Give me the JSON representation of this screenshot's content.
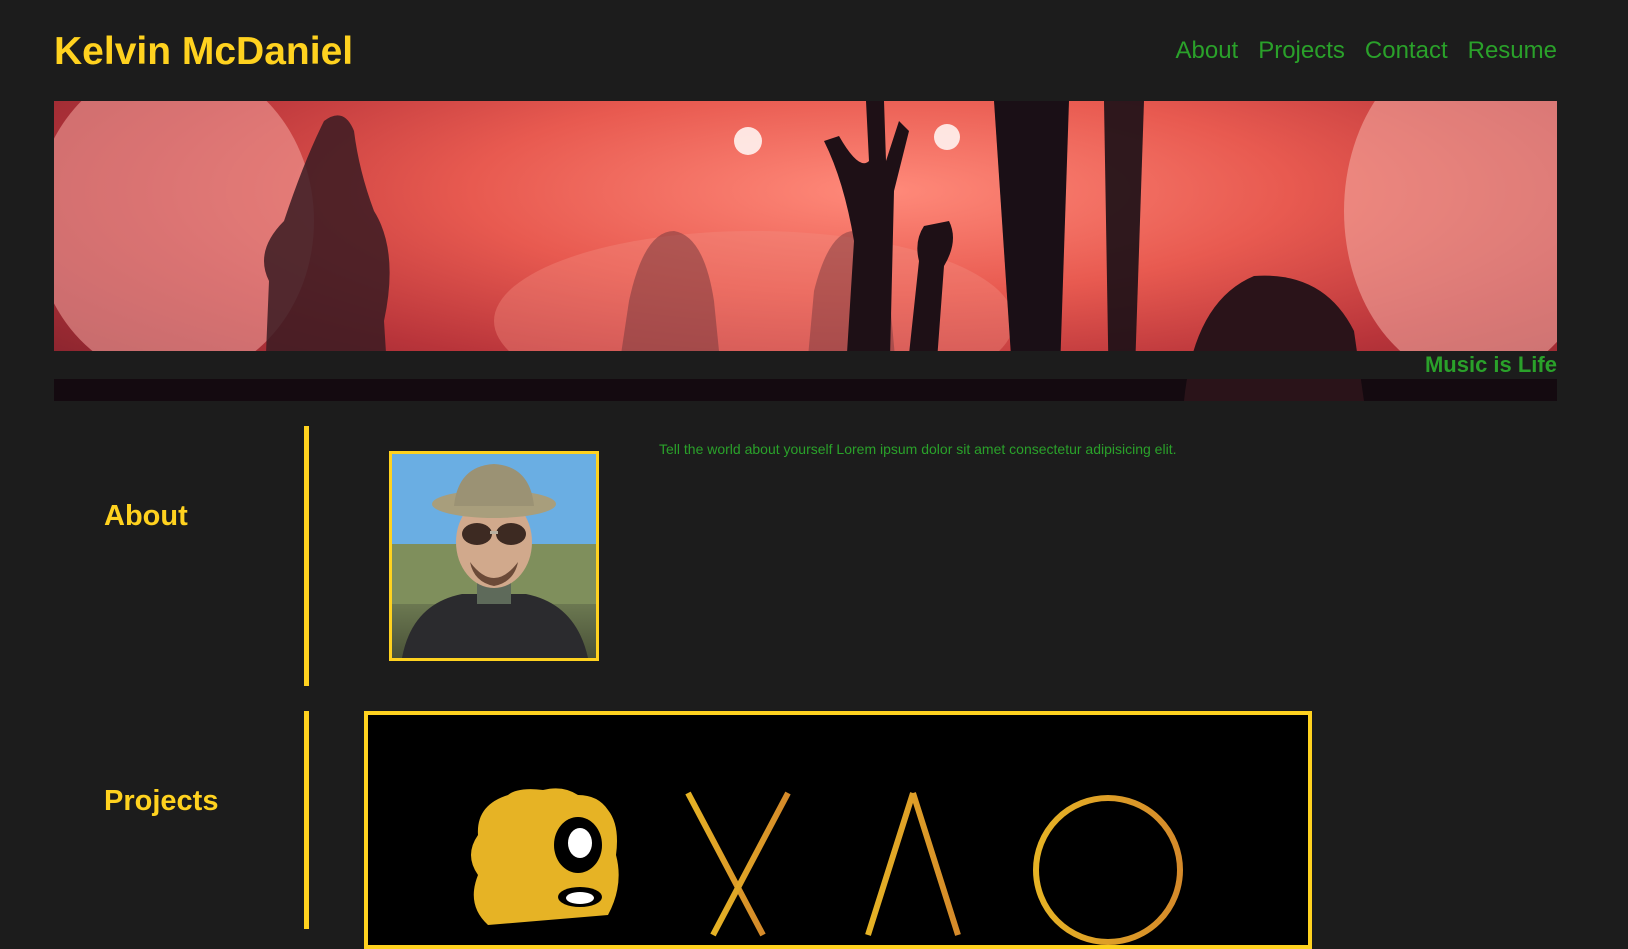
{
  "header": {
    "title": "Kelvin McDaniel",
    "nav": [
      {
        "label": "About"
      },
      {
        "label": "Projects"
      },
      {
        "label": "Contact"
      },
      {
        "label": "Resume"
      }
    ]
  },
  "hero": {
    "caption": "Music is Life",
    "image": "concert-crowd-image"
  },
  "about": {
    "heading": "About",
    "text": "Tell the world about yourself Lorem ipsum dolor sit amet consectetur adipisicing elit.",
    "photo": "profile-photo"
  },
  "projects": {
    "heading": "Projects",
    "image": "project-logo-image"
  },
  "colors": {
    "background": "#1c1c1c",
    "accent_yellow": "#ffd21f",
    "link_green": "#2aa12a"
  }
}
